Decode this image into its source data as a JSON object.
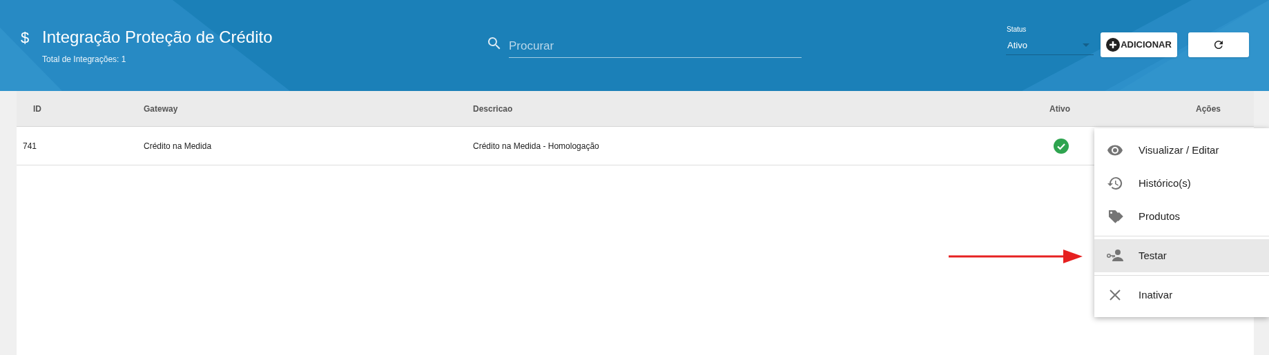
{
  "header": {
    "icon": "$",
    "title": "Integração Proteção de Crédito",
    "subtitle": "Total de Integrações: 1",
    "search": {
      "placeholder": "Procurar"
    },
    "status": {
      "label": "Status",
      "value": "Ativo"
    },
    "add_button": "ADICIONAR"
  },
  "table": {
    "columns": [
      "ID",
      "Gateway",
      "Descricao",
      "Ativo",
      "Ações"
    ],
    "rows": [
      {
        "id": "741",
        "gateway": "Crédito na Medida",
        "descricao": "Crédito na Medida - Homologação",
        "active": true
      }
    ]
  },
  "menu": {
    "items": [
      {
        "kind": "eye",
        "label": "Visualizar / Editar",
        "selected": false,
        "divider_after": false
      },
      {
        "kind": "history",
        "label": "Histórico(s)",
        "selected": false,
        "divider_after": false
      },
      {
        "kind": "tags",
        "label": "Produtos",
        "selected": false,
        "divider_after": true
      },
      {
        "kind": "key-person",
        "label": "Testar",
        "selected": true,
        "divider_after": true
      },
      {
        "kind": "close",
        "label": "Inativar",
        "selected": false,
        "divider_after": false
      }
    ]
  }
}
